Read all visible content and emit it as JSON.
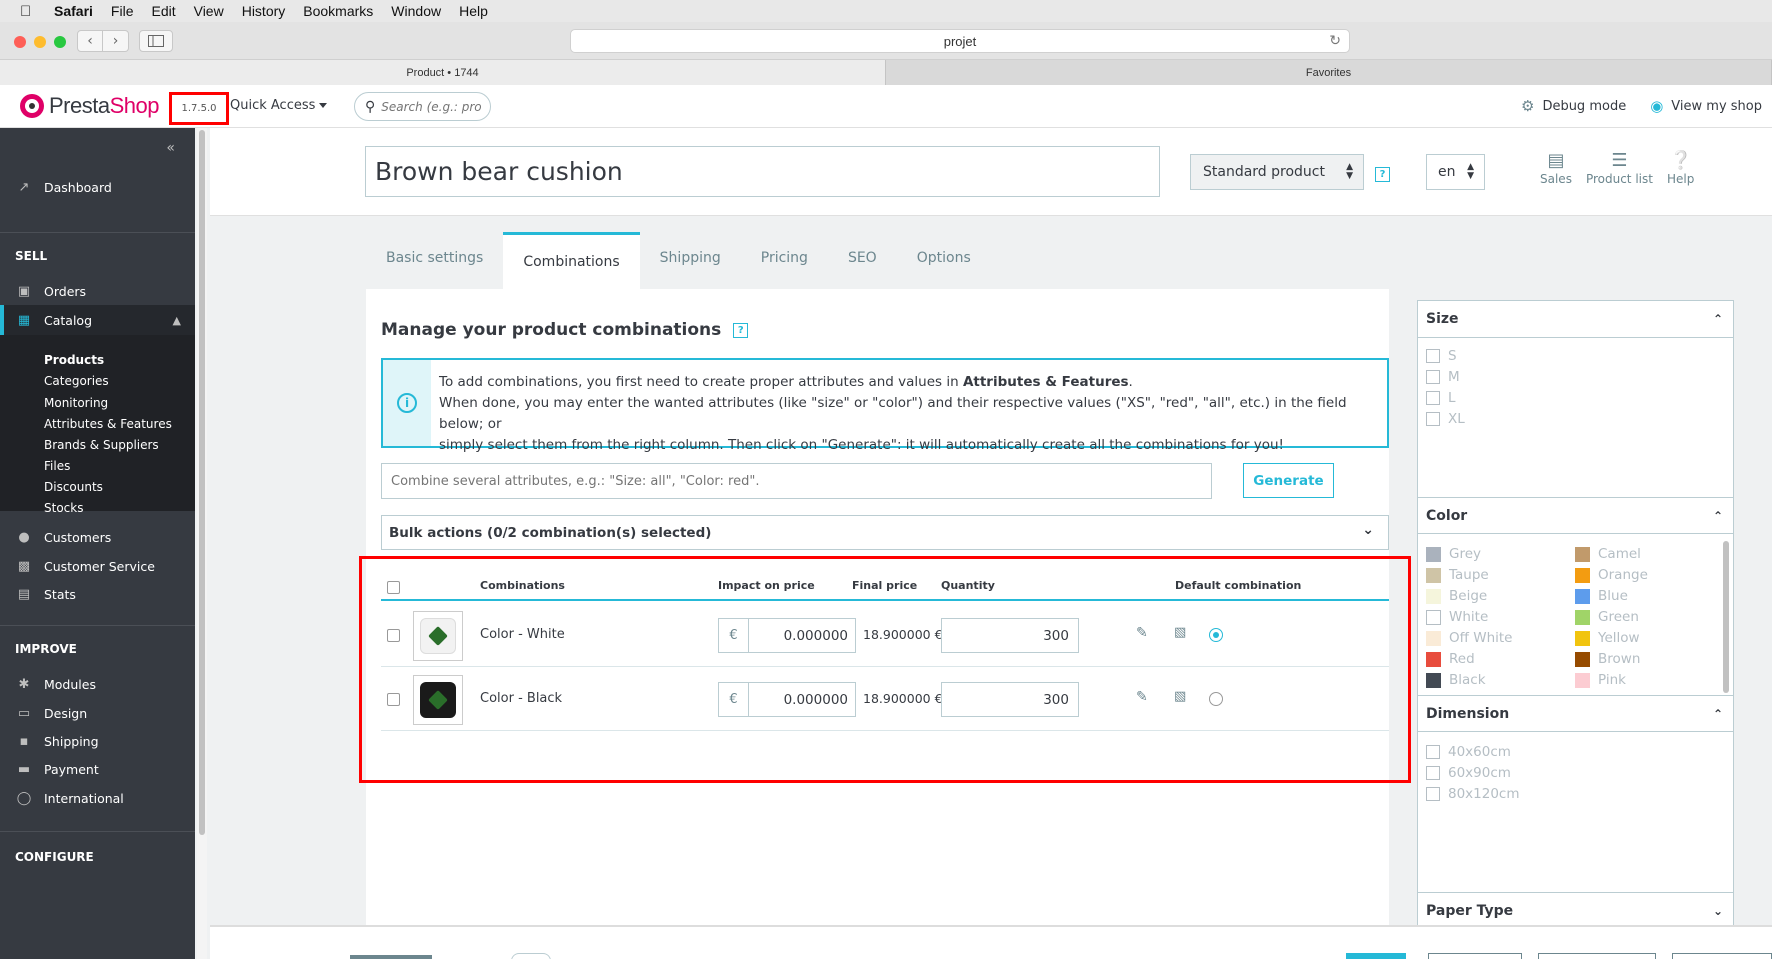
{
  "macos": {
    "menu": [
      "Safari",
      "File",
      "Edit",
      "View",
      "History",
      "Bookmarks",
      "Window",
      "Help"
    ]
  },
  "browser": {
    "url": "projet",
    "tabs": [
      "Product • 1744",
      "Favorites"
    ]
  },
  "header": {
    "logo_prefix": "Presta",
    "logo_suffix": "Shop",
    "version": "1.7.5.0",
    "quick_access": "Quick Access",
    "search_placeholder": "Search (e.g.: product reference, custome",
    "debug_mode": "Debug mode",
    "view_shop": "View my shop"
  },
  "sidebar": {
    "dashboard": "Dashboard",
    "sell_title": "SELL",
    "orders": "Orders",
    "catalog": "Catalog",
    "catalog_sub": [
      "Products",
      "Categories",
      "Monitoring",
      "Attributes & Features",
      "Brands & Suppliers",
      "Files",
      "Discounts",
      "Stocks"
    ],
    "customers": "Customers",
    "customer_service": "Customer Service",
    "stats": "Stats",
    "improve_title": "IMPROVE",
    "modules": "Modules",
    "design": "Design",
    "shipping": "Shipping",
    "payment": "Payment",
    "international": "International",
    "configure_title": "CONFIGURE"
  },
  "product": {
    "name": "Brown bear cushion",
    "type": "Standard product",
    "lang": "en",
    "tools": [
      "Sales",
      "Product list",
      "Help"
    ]
  },
  "tabs": [
    "Basic settings",
    "Combinations",
    "Shipping",
    "Pricing",
    "SEO",
    "Options"
  ],
  "combinations": {
    "title": "Manage your product combinations",
    "info_line1_pre": "To add combinations, you first need to create proper attributes and values in ",
    "info_line1_link": "Attributes & Features",
    "info_line1_post": ".",
    "info_line2": "When done, you may enter the wanted attributes (like \"size\" or \"color\") and their respective values (\"XS\", \"red\", \"all\", etc.) in the field below; or",
    "info_line3": "simply select them from the right column. Then click on \"Generate\": it will automatically create all the combinations for you!",
    "combine_placeholder": "Combine several attributes, e.g.: \"Size: all\", \"Color: red\".",
    "generate": "Generate",
    "bulk_actions": "Bulk actions (0/2 combination(s) selected)",
    "columns": {
      "combinations": "Combinations",
      "impact": "Impact on price",
      "final": "Final price",
      "quantity": "Quantity",
      "default": "Default combination"
    },
    "currency": "€",
    "rows": [
      {
        "name": "Color - White",
        "impact": "0.000000",
        "final": "18.900000 €",
        "quantity": "300",
        "default": true,
        "swatch": "#f2f2f2"
      },
      {
        "name": "Color - Black",
        "impact": "0.000000",
        "final": "18.900000 €",
        "quantity": "300",
        "default": false,
        "swatch": "#1a1a1a"
      }
    ]
  },
  "attributes": {
    "size_title": "Size",
    "sizes": [
      "S",
      "M",
      "L",
      "XL"
    ],
    "color_title": "Color",
    "colors_left": [
      {
        "name": "Grey",
        "hex": "#aab2bd"
      },
      {
        "name": "Taupe",
        "hex": "#cfc4a6"
      },
      {
        "name": "Beige",
        "hex": "#f5f5dc"
      },
      {
        "name": "White",
        "hex": "#ffffff"
      },
      {
        "name": "Off White",
        "hex": "#faebd7"
      },
      {
        "name": "Red",
        "hex": "#e84c3d"
      },
      {
        "name": "Black",
        "hex": "#434a54"
      }
    ],
    "colors_right": [
      {
        "name": "Camel",
        "hex": "#c19a6b"
      },
      {
        "name": "Orange",
        "hex": "#f39c11"
      },
      {
        "name": "Blue",
        "hex": "#5d9cec"
      },
      {
        "name": "Green",
        "hex": "#a0d468"
      },
      {
        "name": "Yellow",
        "hex": "#f1c40f"
      },
      {
        "name": "Brown",
        "hex": "#964b00"
      },
      {
        "name": "Pink",
        "hex": "#fcccd2"
      }
    ],
    "dimension_title": "Dimension",
    "dimensions": [
      "40x60cm",
      "60x90cm",
      "80x120cm"
    ],
    "paper_title": "Paper Type"
  },
  "colors": {
    "accent": "#25b9d7",
    "brand": "#df0067",
    "sidebar": "#363a41",
    "highlight": "#ff0000"
  }
}
